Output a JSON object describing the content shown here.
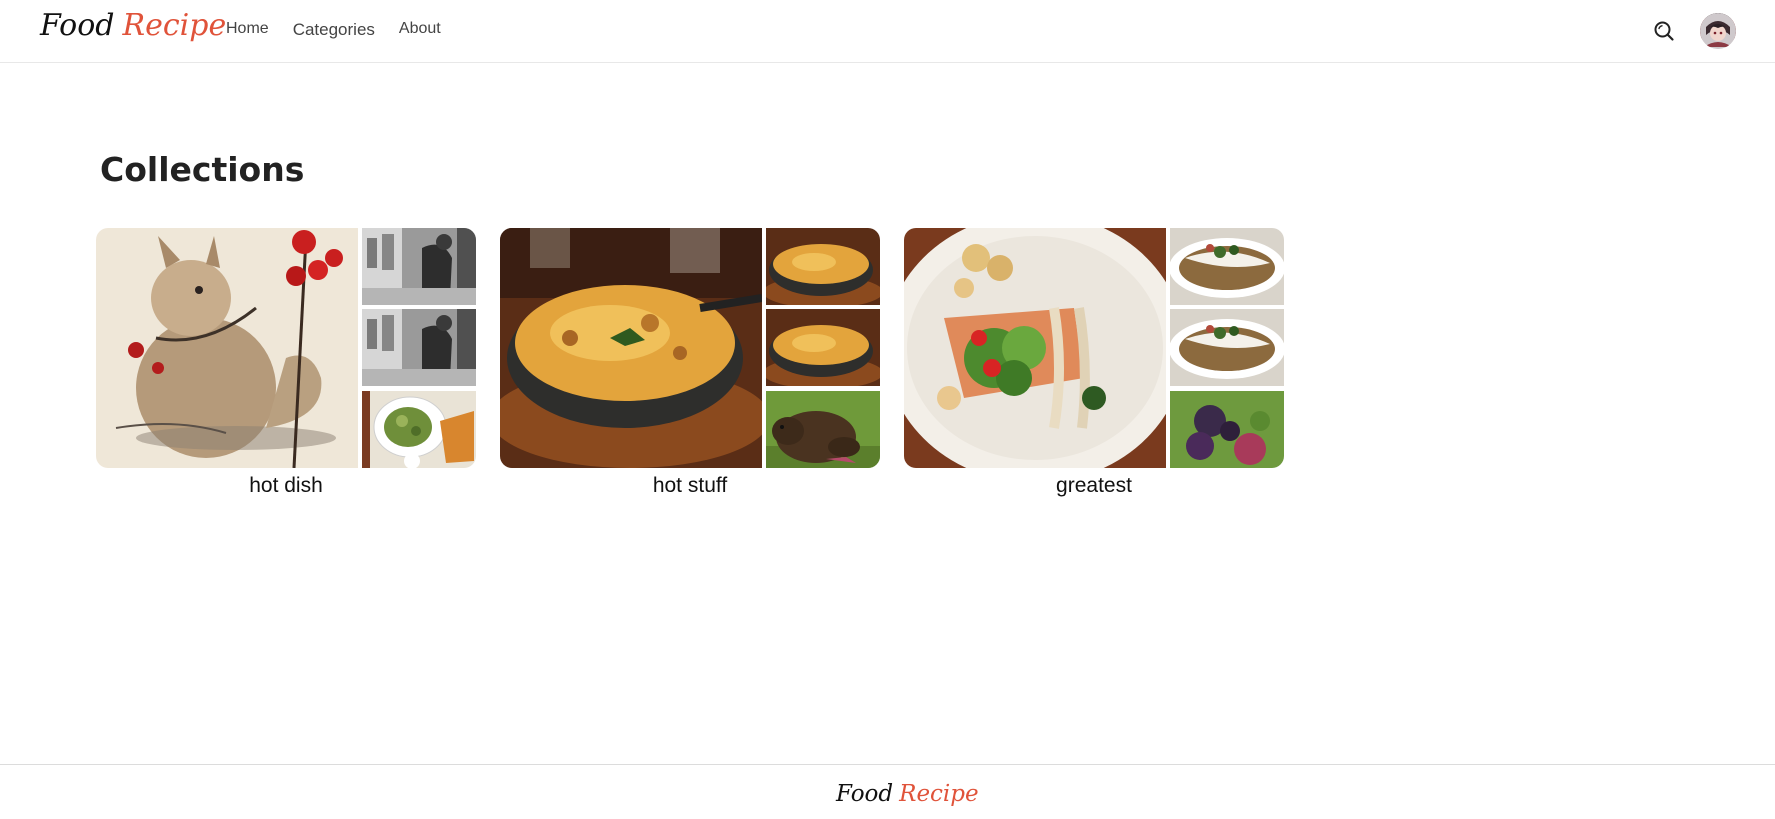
{
  "brand": {
    "word1": "Food",
    "word2": "Recipe",
    "accent_color": "#e0533a"
  },
  "nav": {
    "items": [
      "Home",
      "Categories",
      "About"
    ]
  },
  "header": {
    "search_icon": "search-icon",
    "avatar": "user-avatar"
  },
  "main": {
    "title": "Collections",
    "collections": [
      {
        "name": "hot dish"
      },
      {
        "name": "hot stuff"
      },
      {
        "name": "greatest"
      }
    ]
  },
  "footer": {
    "word1": "Food",
    "word2": "Recipe"
  }
}
